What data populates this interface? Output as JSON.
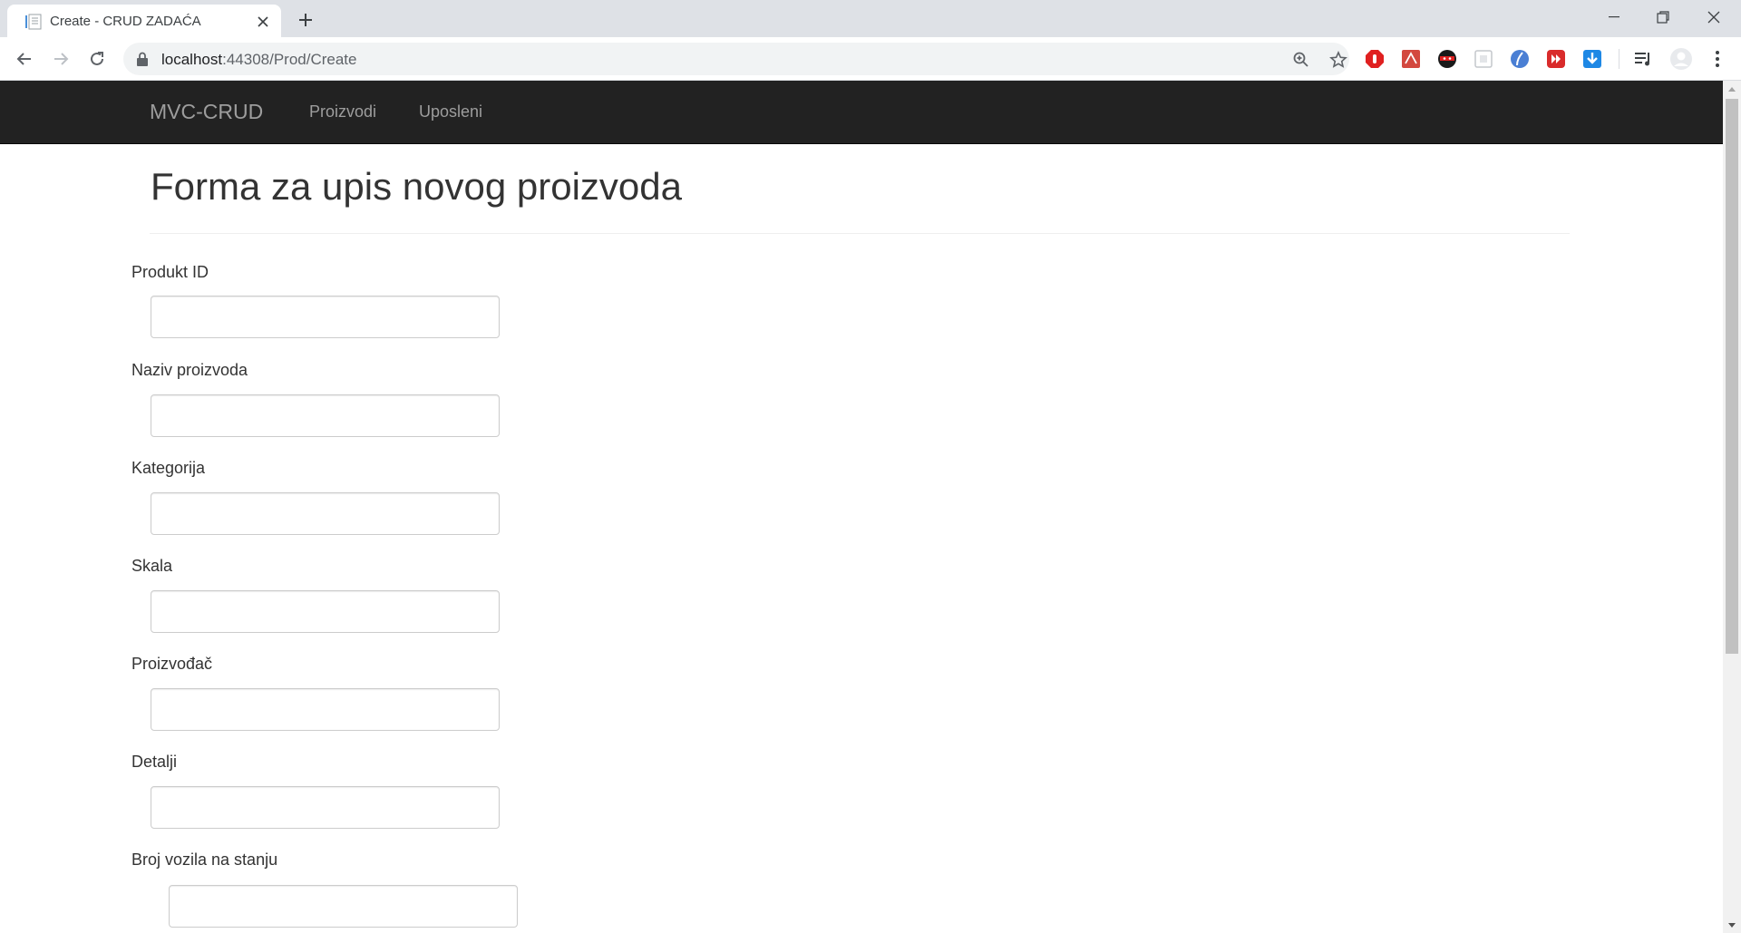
{
  "browser": {
    "tab_title": "Create - CRUD ZADAĆA",
    "url_host": "localhost",
    "url_path": ":44308/Prod/Create"
  },
  "navbar": {
    "brand": "MVC-CRUD",
    "links": [
      "Proizvodi",
      "Uposleni"
    ]
  },
  "page": {
    "title": "Forma za upis novog proizvoda"
  },
  "form": {
    "fields": [
      {
        "label": "Produkt ID",
        "value": ""
      },
      {
        "label": "Naziv proizvoda",
        "value": ""
      },
      {
        "label": "Kategorija",
        "value": ""
      },
      {
        "label": "Skala",
        "value": ""
      },
      {
        "label": "Proizvođač",
        "value": ""
      },
      {
        "label": "Detalji",
        "value": ""
      },
      {
        "label": "Broj vozila na stanju",
        "value": ""
      }
    ]
  },
  "colors": {
    "navbar_bg": "#222222",
    "navbar_text": "#9d9d9d",
    "tabstrip_bg": "#dee1e6"
  },
  "icons": {
    "toolbar": [
      "back-icon",
      "forward-icon",
      "reload-icon",
      "lock-icon",
      "zoom-icon",
      "star-icon"
    ],
    "extensions": [
      "adblock-icon",
      "pdf-icon",
      "ninja-icon",
      "frame-icon",
      "compass-icon",
      "video-icon",
      "download-icon",
      "media-queue-icon",
      "profile-icon",
      "menu-icon"
    ]
  }
}
